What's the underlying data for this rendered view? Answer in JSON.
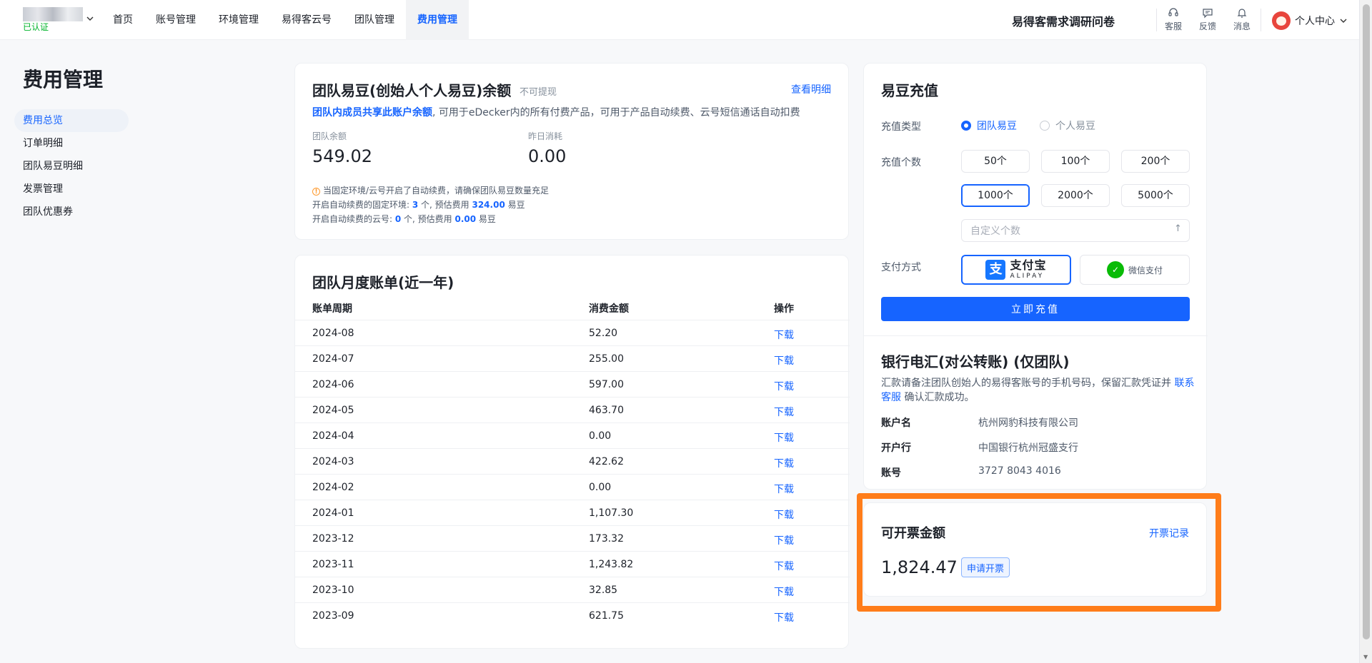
{
  "header": {
    "verified": "已认证",
    "nav": [
      "首页",
      "账号管理",
      "环境管理",
      "易得客云号",
      "团队管理",
      "费用管理"
    ],
    "survey": "易得客需求调研问卷",
    "icons": [
      {
        "label": "客服",
        "icon": "headset-icon"
      },
      {
        "label": "反馈",
        "icon": "feedback-icon"
      },
      {
        "label": "消息",
        "icon": "bell-icon"
      }
    ],
    "user": "个人中心"
  },
  "page": {
    "title": "费用管理"
  },
  "sidebar": {
    "items": [
      "费用总览",
      "订单明细",
      "团队易豆明细",
      "发票管理",
      "团队优惠券"
    ],
    "active": 0
  },
  "balance": {
    "title": "团队易豆(创始人个人易豆)余额",
    "no_withdraw": "不可提现",
    "detail_link": "查看明细",
    "desc_link": "团队内成员共享此账户余额",
    "desc_rest": ", 可用于eDecker内的所有付费产品，可用于产品自动续费、云号短信通话自动扣费",
    "team_balance_label": "团队余额",
    "team_balance": "549.02",
    "yesterday_label": "昨日消耗",
    "yesterday": "0.00",
    "tip1": "当固定环境/云号开启了自动续费，请确保团队易豆数量充足",
    "tip2_pre": "开启自动续费的固定环境: ",
    "tip2_count": "3",
    "tip2_mid": " 个, 预估费用 ",
    "tip2_fee": "324.00",
    "tip2_unit": " 易豆",
    "tip3_pre": "开启自动续费的云号: ",
    "tip3_count": "0",
    "tip3_mid": " 个, 预估费用 ",
    "tip3_fee": "0.00",
    "tip3_unit": " 易豆"
  },
  "bills": {
    "title": "团队月度账单(近一年)",
    "headers": [
      "账单周期",
      "消费金额",
      "操作"
    ],
    "rows": [
      {
        "period": "2024-08",
        "amount": "52.20",
        "action": "下载"
      },
      {
        "period": "2024-07",
        "amount": "255.00",
        "action": "下载"
      },
      {
        "period": "2024-06",
        "amount": "597.00",
        "action": "下载"
      },
      {
        "period": "2024-05",
        "amount": "463.70",
        "action": "下载"
      },
      {
        "period": "2024-04",
        "amount": "0.00",
        "action": "下载"
      },
      {
        "period": "2024-03",
        "amount": "422.62",
        "action": "下载"
      },
      {
        "period": "2024-02",
        "amount": "0.00",
        "action": "下载"
      },
      {
        "period": "2024-01",
        "amount": "1,107.30",
        "action": "下载"
      },
      {
        "period": "2023-12",
        "amount": "173.32",
        "action": "下载"
      },
      {
        "period": "2023-11",
        "amount": "1,243.82",
        "action": "下载"
      },
      {
        "period": "2023-10",
        "amount": "32.85",
        "action": "下载"
      },
      {
        "period": "2023-09",
        "amount": "621.75",
        "action": "下载"
      }
    ]
  },
  "recharge": {
    "title": "易豆充值",
    "type_label": "充值类型",
    "types": [
      "团队易豆",
      "个人易豆"
    ],
    "type_selected": 0,
    "count_label": "充值个数",
    "counts": [
      "50个",
      "100个",
      "200个",
      "1000个",
      "2000个",
      "5000个"
    ],
    "count_selected": 3,
    "custom_placeholder": "自定义个数",
    "pay_label": "支付方式",
    "alipay_cn": "支付宝",
    "alipay_en": "ALIPAY",
    "wechat": "微信支付",
    "pay_selected": "alipay",
    "button": "立即充值"
  },
  "bank": {
    "title": "银行电汇(对公转账) (仅团队)",
    "desc_pre": "汇款请备注团队创始人的易得客账号的手机号码，保留汇款凭证并 ",
    "desc_link": "联系客服",
    "desc_post": " 确认汇款成功。",
    "fields": [
      {
        "key": "账户名",
        "value": "杭州网豹科技有限公司"
      },
      {
        "key": "开户行",
        "value": "中国银行杭州冠盛支行"
      },
      {
        "key": "账号",
        "value": "3727 8043 4016"
      }
    ]
  },
  "invoice": {
    "title": "可开票金额",
    "records": "开票记录",
    "amount": "1,824.47",
    "apply": "申请开票"
  },
  "colors": {
    "accent": "#1664ff",
    "highlight": "#ff7d1a",
    "verified": "#00b42a",
    "warning": "#ff9a2e"
  }
}
